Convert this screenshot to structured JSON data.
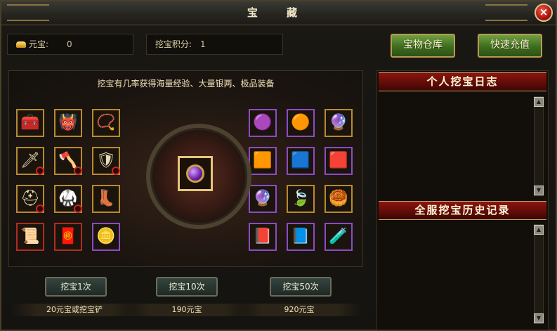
{
  "window": {
    "title": "宝 藏",
    "close_label": "×"
  },
  "stats": {
    "yuanbao_label": "元宝:",
    "yuanbao_value": "0",
    "points_label": "挖宝积分:",
    "points_value": "1"
  },
  "top_buttons": {
    "warehouse": "宝物仓库",
    "recharge": "快速充值"
  },
  "main": {
    "hint": "挖宝有几率获得海量经验、大量银两、极品装备",
    "left_items": [
      {
        "icon": "treasure-chest-icon",
        "glyph": "🧰",
        "border": "gold",
        "locked": false
      },
      {
        "icon": "purple-mask-icon",
        "glyph": "👹",
        "border": "gold",
        "locked": false
      },
      {
        "icon": "necklace-icon",
        "glyph": "📿",
        "border": "gold",
        "locked": false
      },
      {
        "icon": "blade-icon",
        "glyph": "🗡",
        "border": "gold",
        "locked": true
      },
      {
        "icon": "axe-icon",
        "glyph": "🪓",
        "border": "gold",
        "locked": true
      },
      {
        "icon": "gauntlet-icon",
        "glyph": "🛡",
        "border": "gold",
        "locked": true
      },
      {
        "icon": "helmet-icon",
        "glyph": "⛑",
        "border": "gold",
        "locked": true
      },
      {
        "icon": "green-armor-icon",
        "glyph": "🥋",
        "border": "gold",
        "locked": true
      },
      {
        "icon": "red-boots-icon",
        "glyph": "👢",
        "border": "gold",
        "locked": false
      },
      {
        "icon": "scroll-icon",
        "glyph": "📜",
        "border": "red",
        "locked": false
      },
      {
        "icon": "red-talisman-icon",
        "glyph": "🧧",
        "border": "red",
        "locked": false
      },
      {
        "icon": "gold-ingot-icon",
        "glyph": "🪙",
        "border": "purple",
        "locked": false
      }
    ],
    "right_items": [
      {
        "icon": "purple-orb-icon",
        "glyph": "🟣",
        "border": "purple"
      },
      {
        "icon": "gold-orb-icon",
        "glyph": "🟠",
        "border": "purple"
      },
      {
        "icon": "exp-orb-icon",
        "glyph": "🔮",
        "border": "gold"
      },
      {
        "icon": "orange-gem-icon",
        "glyph": "🟧",
        "border": "purple"
      },
      {
        "icon": "blue-gem-icon",
        "glyph": "🟦",
        "border": "purple"
      },
      {
        "icon": "red-gem-icon",
        "glyph": "🟥",
        "border": "purple"
      },
      {
        "icon": "crystal-ball-icon",
        "glyph": "🔮",
        "border": "purple"
      },
      {
        "icon": "green-jade-icon",
        "glyph": "🍃",
        "border": "gold"
      },
      {
        "icon": "gold-nugget-icon",
        "glyph": "🥮",
        "border": "gold"
      },
      {
        "icon": "red-scroll-icon",
        "glyph": "📕",
        "border": "purple"
      },
      {
        "icon": "blue-scroll-icon",
        "glyph": "📘",
        "border": "purple"
      },
      {
        "icon": "potion-bottle-icon",
        "glyph": "🧪",
        "border": "purple"
      }
    ]
  },
  "dig": [
    {
      "label": "挖宝1次",
      "cost": "20元宝或挖宝铲"
    },
    {
      "label": "挖宝10次",
      "cost": "190元宝"
    },
    {
      "label": "挖宝50次",
      "cost": "920元宝"
    }
  ],
  "logs": {
    "personal_title": "个人挖宝日志",
    "server_title": "全服挖宝历史记录",
    "scroll_up": "▲",
    "scroll_down": "▼"
  }
}
